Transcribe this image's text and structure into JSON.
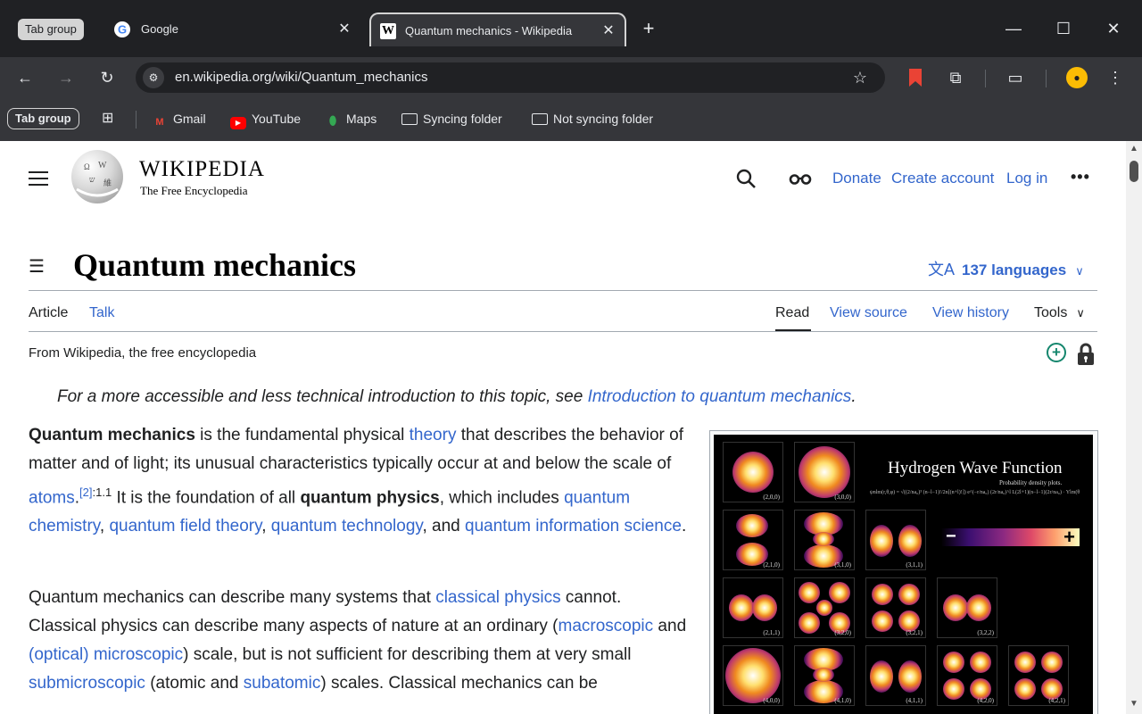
{
  "browser": {
    "tab_group_label": "Tab group",
    "tabs": [
      {
        "title": "Google",
        "favicon": "google-favicon"
      },
      {
        "title": "Quantum mechanics - Wikipedia",
        "favicon": "wikipedia-favicon",
        "active": true
      }
    ],
    "favicon_w": "W",
    "new_tab": "+",
    "tab_close": "✕",
    "window_controls": {
      "minimize": "—",
      "maximize": "☐",
      "close": "✕"
    },
    "url": "en.wikipedia.org/wiki/Quantum_mechanics",
    "bookmarks": {
      "group_chip": "Tab group",
      "items": [
        "Gmail",
        "YouTube",
        "Maps",
        "Syncing folder",
        "Not syncing folder"
      ]
    }
  },
  "wiki": {
    "wordmark": "WIKIPEDIA",
    "tagline": "The Free Encyclopedia",
    "header_links": {
      "donate": "Donate",
      "create_account": "Create account",
      "login": "Log in"
    },
    "title": "Quantum mechanics",
    "languages": "137 languages",
    "tabs": {
      "article": "Article",
      "talk": "Talk",
      "read": "Read",
      "view_source": "View source",
      "view_history": "View history",
      "tools": "Tools"
    },
    "sitesub": "From Wikipedia, the free encyclopedia",
    "hatnote": {
      "prefix": "For a more accessible and less technical introduction to this topic, see ",
      "link": "Introduction to quantum mechanics",
      "suffix": "."
    },
    "p1": {
      "bold1": "Quantum mechanics",
      "t1": " is the fundamental physical ",
      "l_theory": "theory",
      "t2": " that describes the behavior of matter and of light; its unusual characteristics typically occur at and below the scale of ",
      "l_atoms": "atoms",
      "t3": ".",
      "ref": "[2]",
      "ref_page": ":1.1",
      "t4": " It is the foundation of all ",
      "bold2": "quantum physics",
      "t5": ", which includes ",
      "l_qc": "quantum chemistry",
      "c1": ", ",
      "l_qft": "quantum field theory",
      "c2": ", ",
      "l_qt": "quantum technology",
      "t6": ", and ",
      "l_qis": "quantum information science",
      "t7": "."
    },
    "p2": {
      "t1": "Quantum mechanics can describe many systems that ",
      "l_cp": "classical physics",
      "t2": " cannot. Classical physics can describe many aspects of nature at an ordinary (",
      "l_macro": "macroscopic",
      "t3": " and ",
      "l_micro": "(optical) microscopic",
      "t4": ") scale, but is not sufficient for describing them at very small ",
      "l_submicro": "submicroscopic",
      "t5": " (atomic and ",
      "l_subatomic": "subatomic",
      "t6": ") scales. Classical mechanics can be"
    },
    "figure": {
      "title": "Hydrogen Wave Function",
      "subtitle": "Probability density plots.",
      "equation": "ψnlm(r,θ,φ) = √((2/na₀)³ (n−l−1)!/2n[(n+l)!]) e^(−r/na₀) (2r/na₀)^l L(2l+1)(n−l−1)(2r/na₀) · Ylm(θ,φ)",
      "colorbar_minus": "−",
      "colorbar_plus": "+",
      "orbitals": [
        "(2,0,0)",
        "(3,0,0)",
        "(2,1,0)",
        "(3,1,0)",
        "(3,1,1)",
        "(2,1,1)",
        "(3,2,0)",
        "(3,2,1)",
        "(3,2,2)",
        "(4,0,0)",
        "(4,1,0)",
        "(4,1,1)",
        "(4,2,0)",
        "(4,2,1)"
      ]
    }
  }
}
